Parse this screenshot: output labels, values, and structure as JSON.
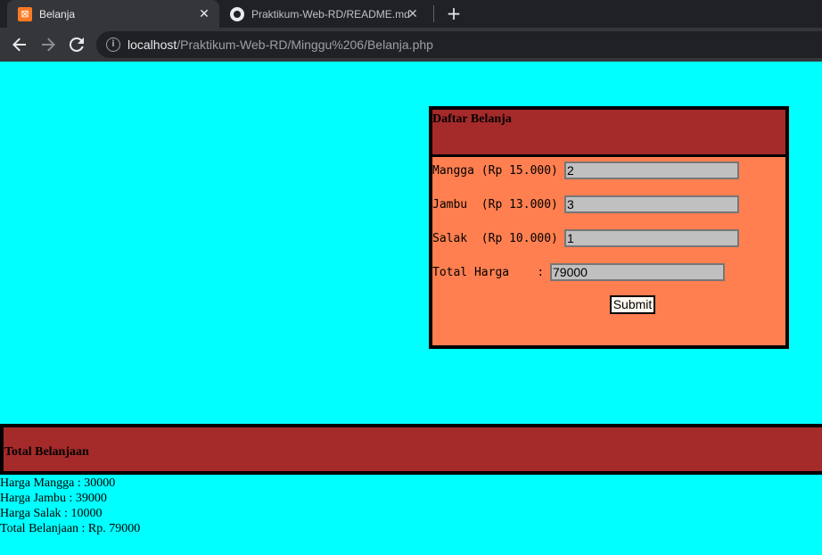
{
  "browser": {
    "tabs": [
      {
        "title": "Belanja",
        "favicon": "xampp-icon",
        "active": true
      },
      {
        "title": "Praktikum-Web-RD/README.md",
        "favicon": "github-icon",
        "active": false
      }
    ],
    "url": {
      "host": "localhost",
      "path": "/Praktikum-Web-RD/Minggu%206/Belanja.php"
    }
  },
  "form": {
    "title": "Daftar Belanja",
    "rows": [
      {
        "label": "Mangga (Rp 15.000)",
        "value": "2"
      },
      {
        "label": "Jambu  (Rp 13.000)",
        "value": "3"
      },
      {
        "label": "Salak  (Rp 10.000)",
        "value": "1"
      }
    ],
    "total": {
      "label": "Total Harga    :",
      "value": "79000"
    },
    "submit_label": "Submit"
  },
  "summary": {
    "title": "Total Belanjaan",
    "lines": [
      "Harga Mangga : 30000",
      "Harga Jambu : 39000",
      "Harga Salak : 10000",
      "Total Belanjaan : Rp. 79000"
    ]
  },
  "colors": {
    "page_background": "#00ffff",
    "header_background": "#a52a2a",
    "form_background": "#ff7f50"
  }
}
